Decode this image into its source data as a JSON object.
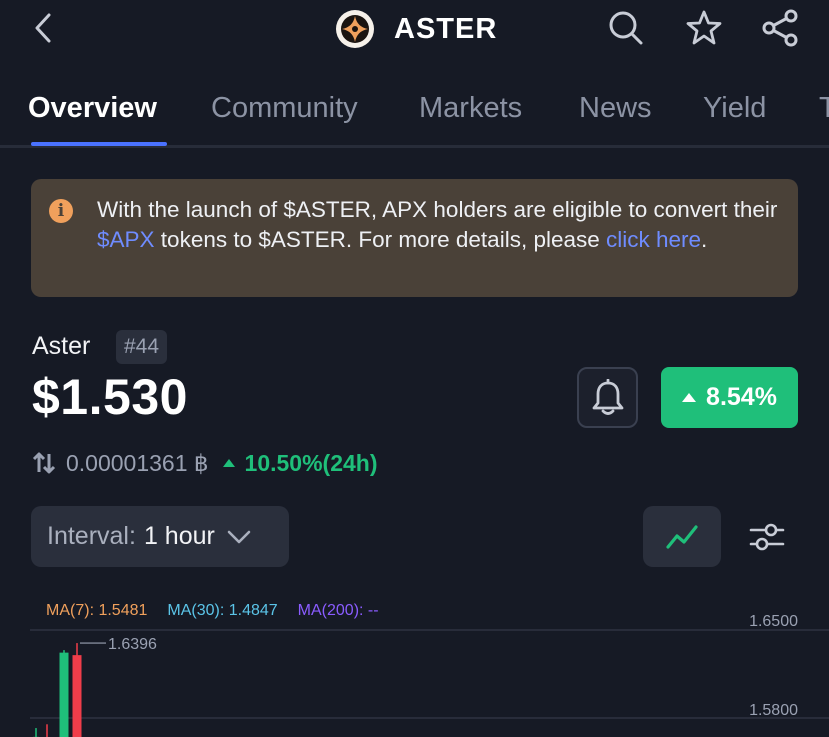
{
  "header": {
    "title": "ASTER",
    "icons": [
      "back-icon",
      "search-icon",
      "star-icon",
      "share-icon"
    ]
  },
  "tabs": [
    {
      "label": "Overview",
      "active": true
    },
    {
      "label": "Community",
      "active": false
    },
    {
      "label": "Markets",
      "active": false
    },
    {
      "label": "News",
      "active": false
    },
    {
      "label": "Yield",
      "active": false
    },
    {
      "label": "T",
      "active": false
    }
  ],
  "notice": {
    "text_1": "With the launch of $ASTER, APX holders are eligible to convert their ",
    "link_1": "$APX",
    "text_2": " tokens to $ASTER. For more details, please ",
    "link_2": "click here",
    "text_3": ".",
    "bg_color": "#4a4138",
    "link_color": "#6f8cff"
  },
  "coin": {
    "name": "Aster",
    "rank": "#44",
    "price": "$1.530",
    "change_24h": "8.54%",
    "btc_price": "0.00001361 ฿",
    "btc_change": "10.50%(24h)",
    "positive_color": "#1fbf7a"
  },
  "interval": {
    "label": "Interval:",
    "value": "1 hour"
  },
  "chart_data": {
    "type": "candlestick",
    "ma": [
      {
        "name": "MA(7)",
        "value": "1.5481",
        "color": "#f0a05c"
      },
      {
        "name": "MA(30)",
        "value": "1.4847",
        "color": "#5bc4e8"
      },
      {
        "name": "MA(200)",
        "value": "--",
        "color": "#8a5cff"
      }
    ],
    "y_ticks": [
      "1.6500",
      "1.5800"
    ],
    "annotation": "1.6396",
    "ylim": [
      1.56,
      1.67
    ],
    "candles": [
      {
        "open": 1.545,
        "close": 1.565,
        "high": 1.572,
        "low": 1.54,
        "color": "green"
      },
      {
        "open": 1.56,
        "close": 1.542,
        "high": 1.575,
        "low": 1.538,
        "color": "red"
      },
      {
        "open": 1.548,
        "close": 1.632,
        "high": 1.634,
        "low": 1.545,
        "color": "green"
      },
      {
        "open": 1.63,
        "close": 1.56,
        "high": 1.6396,
        "low": 1.555,
        "color": "red"
      }
    ]
  }
}
